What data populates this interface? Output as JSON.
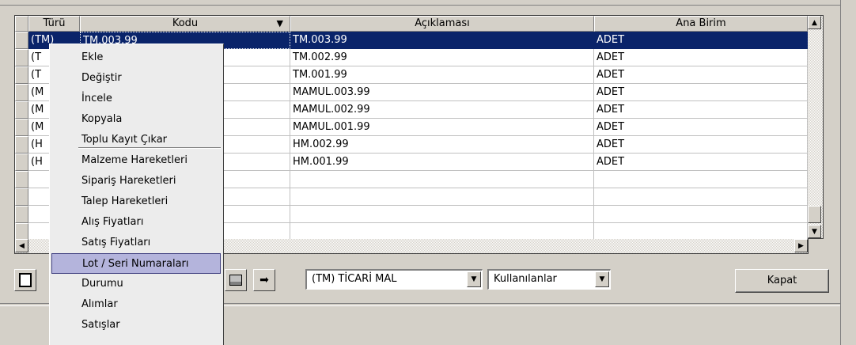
{
  "grid": {
    "columns": [
      "Türü",
      "Kodu",
      "Açıklaması",
      "Ana Birim"
    ],
    "rows": [
      {
        "turu": "(TM)",
        "kodu": "TM.003.99",
        "aciklama": "TM.003.99",
        "birim": "ADET",
        "selected": true
      },
      {
        "turu": "(T",
        "kodu": "",
        "aciklama": "TM.002.99",
        "birim": "ADET"
      },
      {
        "turu": "(T",
        "kodu": "",
        "aciklama": "TM.001.99",
        "birim": "ADET"
      },
      {
        "turu": "(M",
        "kodu": "",
        "aciklama": "MAMUL.003.99",
        "birim": "ADET"
      },
      {
        "turu": "(M",
        "kodu": "",
        "aciklama": "MAMUL.002.99",
        "birim": "ADET"
      },
      {
        "turu": "(M",
        "kodu": "",
        "aciklama": "MAMUL.001.99",
        "birim": "ADET"
      },
      {
        "turu": "(H",
        "kodu": "",
        "aciklama": "HM.002.99",
        "birim": "ADET"
      },
      {
        "turu": "(H",
        "kodu": "",
        "aciklama": "HM.001.99",
        "birim": "ADET"
      }
    ]
  },
  "context_menu": {
    "items": [
      "Ekle",
      "Değiştir",
      "İncele",
      "Kopyala",
      "Toplu Kayıt Çıkar",
      "Malzeme Hareketleri",
      "Sipariş Hareketleri",
      "Talep Hareketleri",
      "Alış Fiyatları",
      "Satış Fiyatları",
      "Lot / Seri Numaraları",
      "Durumu",
      "Alımlar",
      "Satışlar"
    ],
    "highlighted": "Lot / Seri Numaraları"
  },
  "toolbar": {
    "type_filter": "(TM) TİCARİ MAL",
    "usage_filter": "Kullanılanlar",
    "close_label": "Kapat"
  },
  "colors": {
    "selection": "#0a246a",
    "menu_highlight": "#b4b4dc"
  }
}
